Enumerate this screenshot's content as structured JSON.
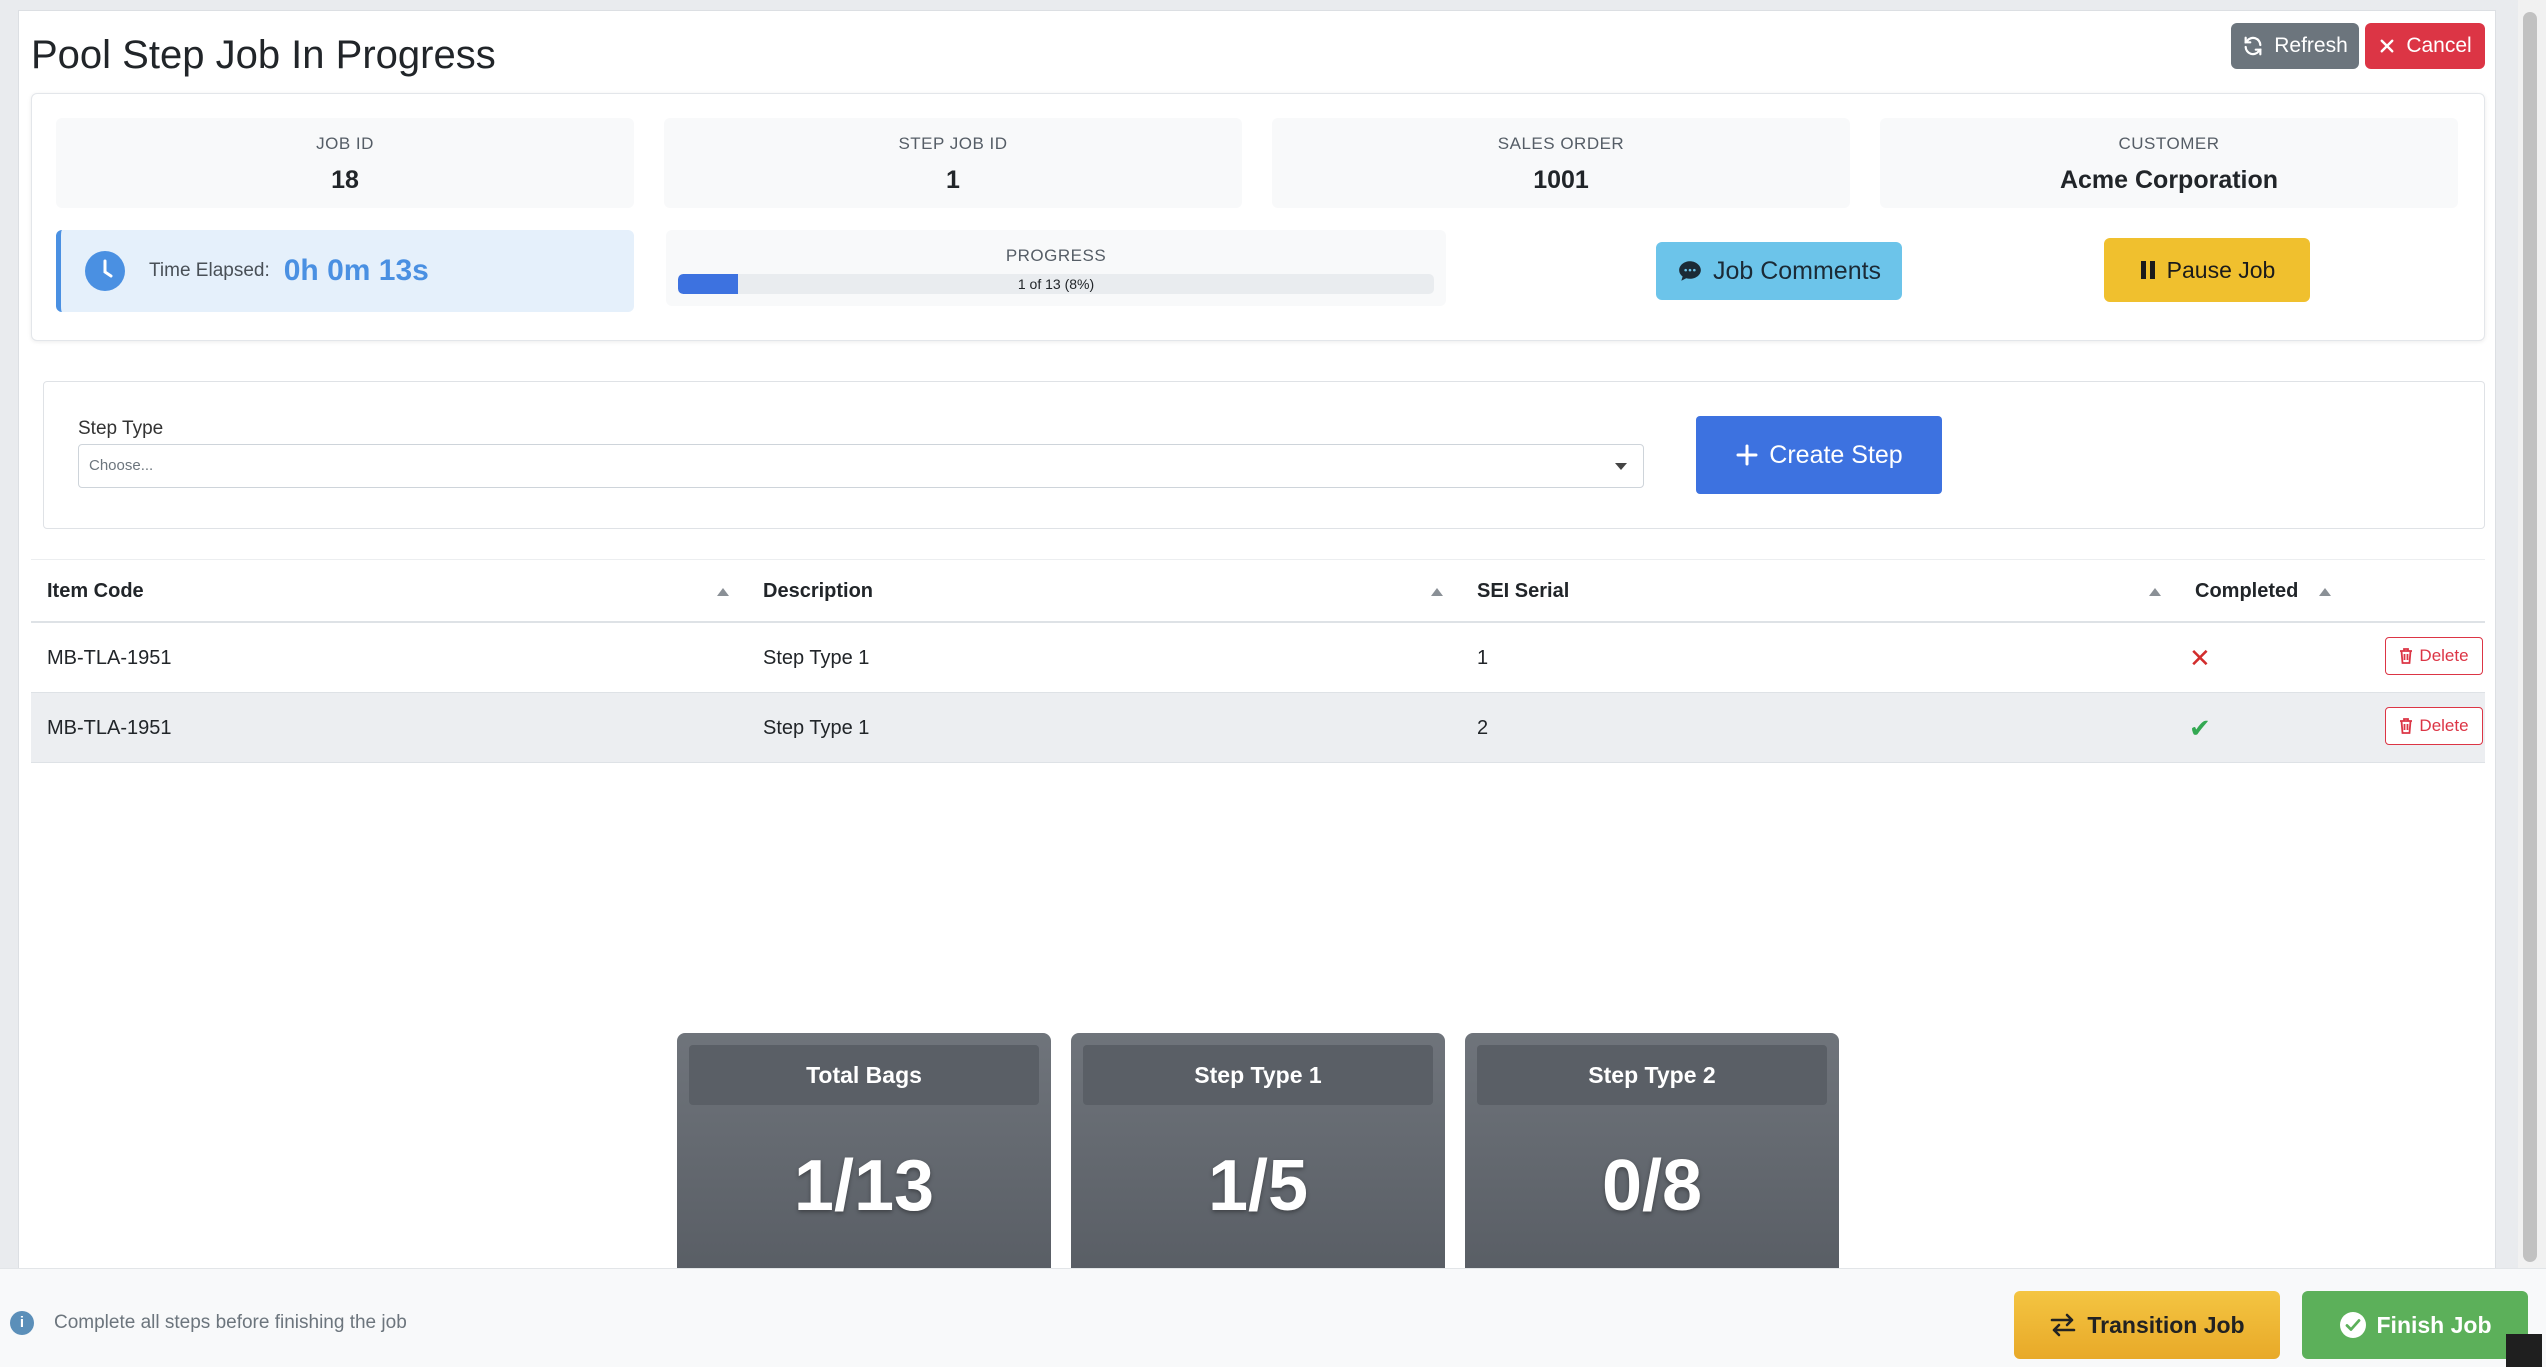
{
  "header": {
    "title": "Pool Step Job In Progress",
    "refresh_label": "Refresh",
    "cancel_label": "Cancel"
  },
  "stats": [
    {
      "label": "JOB ID",
      "value": "18"
    },
    {
      "label": "STEP JOB ID",
      "value": "1"
    },
    {
      "label": "SALES ORDER",
      "value": "1001"
    },
    {
      "label": "CUSTOMER",
      "value": "Acme Corporation"
    }
  ],
  "timer": {
    "label": "Time Elapsed:",
    "value": "0h 0m 13s"
  },
  "progress": {
    "label": "PROGRESS",
    "text": "1 of 13 (8%)",
    "percent": 8
  },
  "actions": {
    "comments_label": "Job Comments",
    "pause_label": "Pause Job"
  },
  "step_form": {
    "label": "Step Type",
    "placeholder": "Choose...",
    "create_label": "Create Step"
  },
  "table": {
    "columns": [
      "Item Code",
      "Description",
      "SEI Serial",
      "Completed"
    ],
    "rows": [
      {
        "item_code": "MB-TLA-1951",
        "description": "Step Type 1",
        "serial": "1",
        "completed": false,
        "delete_label": "Delete"
      },
      {
        "item_code": "MB-TLA-1951",
        "description": "Step Type 1",
        "serial": "2",
        "completed": true,
        "delete_label": "Delete"
      }
    ]
  },
  "tiles": [
    {
      "title": "Total Bags",
      "value": "1/13"
    },
    {
      "title": "Step Type 1",
      "value": "1/5"
    },
    {
      "title": "Step Type 2",
      "value": "0/8"
    }
  ],
  "footer": {
    "message": "Complete all steps before finishing the job",
    "transition_label": "Transition Job",
    "finish_label": "Finish Job"
  },
  "colors": {
    "primary": "#3d72e0",
    "danger": "#dc3545",
    "success": "#5cb05a",
    "warning": "#f0c02e",
    "info": "#6cc4ea"
  }
}
